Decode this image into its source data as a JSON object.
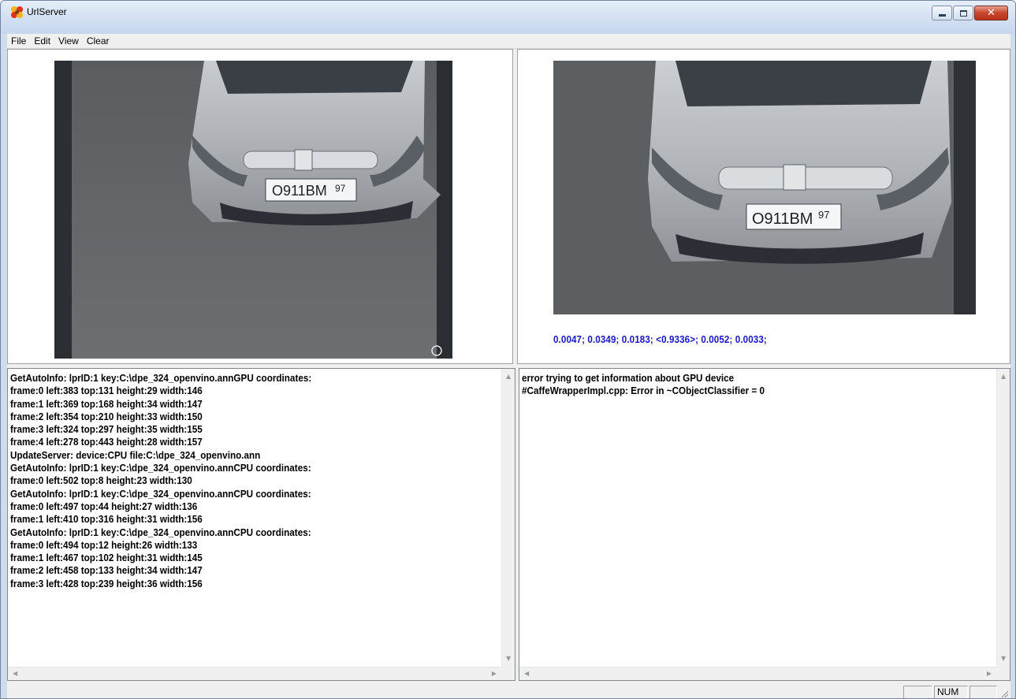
{
  "window": {
    "title": "UrlServer",
    "icon": "app-icon"
  },
  "menu": [
    {
      "label": "File"
    },
    {
      "label": "Edit"
    },
    {
      "label": "View"
    },
    {
      "label": "Clear"
    }
  ],
  "right_panel": {
    "scores": "0.0047; 0.0349; 0.0183; <0.9336>; 0.0052; 0.0033;"
  },
  "left_log": {
    "lines": [
      "GetAutoInfo: lprID:1 key:C:\\dpe_324_openvino.annGPU coordinates:",
      "frame:0 left:383 top:131 height:29 width:146",
      "frame:1 left:369 top:168 height:34 width:147",
      "frame:2 left:354 top:210 height:33 width:150",
      "frame:3 left:324 top:297 height:35 width:155",
      "frame:4 left:278 top:443 height:28 width:157",
      "UpdateServer: device:CPU file:C:\\dpe_324_openvino.ann",
      "GetAutoInfo: lprID:1 key:C:\\dpe_324_openvino.annCPU coordinates:",
      "frame:0 left:502 top:8 height:23 width:130",
      "GetAutoInfo: lprID:1 key:C:\\dpe_324_openvino.annCPU coordinates:",
      "frame:0 left:497 top:44 height:27 width:136",
      "frame:1 left:410 top:316 height:31 width:156",
      "GetAutoInfo: lprID:1 key:C:\\dpe_324_openvino.annCPU coordinates:",
      "frame:0 left:494 top:12 height:26 width:133",
      "frame:1 left:467 top:102 height:31 width:145",
      "frame:2 left:458 top:133 height:34 width:147",
      "frame:3 left:428 top:239 height:36 width:156"
    ]
  },
  "right_log": {
    "lines": [
      "error trying to get information about GPU device",
      "#CaffeWrapperImpl.cpp: Error in ~CObjectClassifier = 0"
    ]
  },
  "plates": {
    "left": {
      "number": "O911BM",
      "region": "97"
    },
    "right": {
      "number": "O911BM",
      "region": "97"
    }
  },
  "statusbar": {
    "num": "NUM"
  },
  "colors": {
    "score_text": "#1818c8",
    "titlebar": "#d5e2f3"
  }
}
